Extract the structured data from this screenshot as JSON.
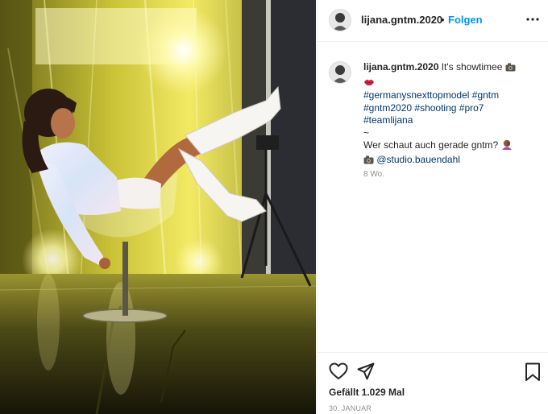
{
  "post": {
    "username": "lijana.gntm.2020",
    "separator": "•",
    "follow_label": "Folgen",
    "more_label": "•••",
    "image_alt": "Frau in weißen Stiefeln auf einem transparenten Stuhl vor gelbem Folienhintergrund"
  },
  "caption": {
    "username": "lijana.gntm.2020",
    "text": "It's showtimee",
    "hashtags": [
      "#germanysnexttopmodel",
      "#gntm",
      "#gntm2020",
      "#shooting",
      "#pro7",
      "#teamlijana"
    ],
    "tilde": "~",
    "question": "Wer schaut auch gerade gntm?",
    "mention": "@studio.bauendahl",
    "age": "8 Wo."
  },
  "actions": {
    "likes": "Gefällt 1.029 Mal",
    "date": "30. JANUAR"
  },
  "colors": {
    "accent": "#0095f6",
    "link": "#00376b",
    "muted": "#8e8e8e",
    "text": "#262626",
    "border": "#efefef"
  },
  "icons": {
    "like": "heart-icon",
    "share": "paper-plane-icon",
    "save": "bookmark-icon",
    "camera": "camera-emoji-icon",
    "lips": "lips-emoji-icon",
    "facepalm": "person-facepalming-emoji-icon"
  }
}
